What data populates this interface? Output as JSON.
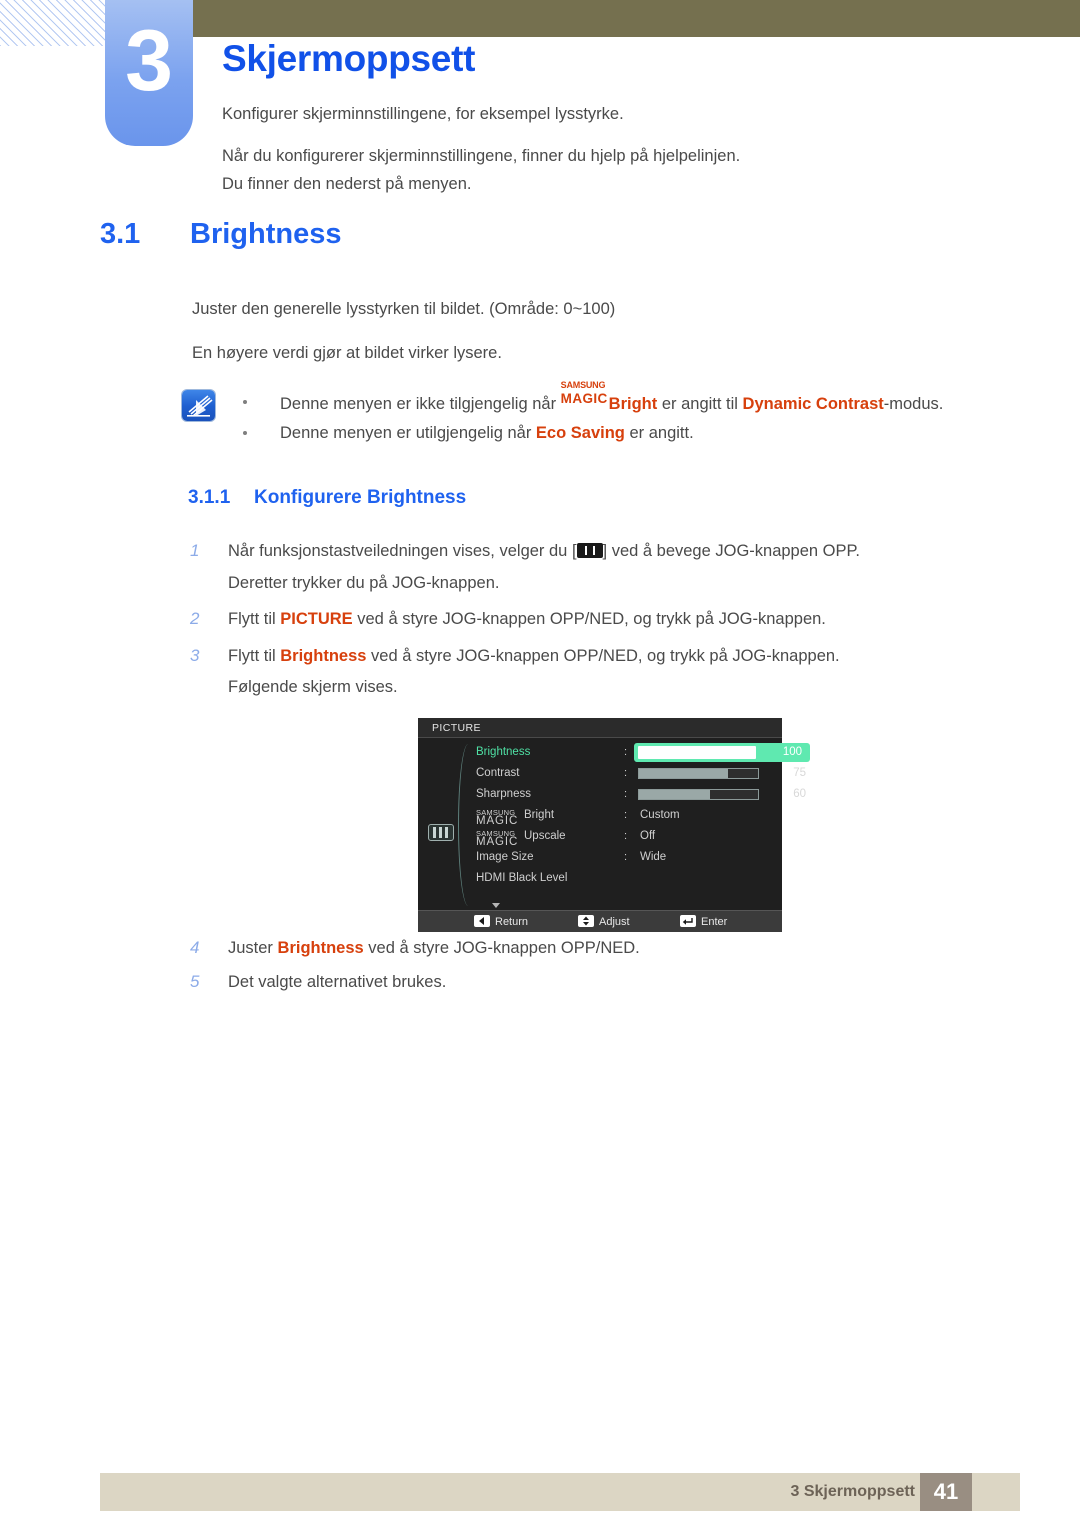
{
  "header": {
    "chapter_number": "3",
    "chapter_title": "Skjermoppsett",
    "intro_line_1": "Konfigurer skjerminnstillingene, for eksempel lysstyrke.",
    "intro_line_2": "Når du konfigurerer skjerminnstillingene, finner du hjelp på hjelpelinjen.",
    "intro_line_3": "Du finner den nederst på menyen."
  },
  "section": {
    "number": "3.1",
    "title": "Brightness",
    "para_1": "Juster den generelle lysstyrken til bildet. (Område: 0~100)",
    "para_2": "En høyere verdi gjør at bildet virker lysere."
  },
  "note": {
    "item_1_pre": "Denne menyen er ikke tilgjengelig når ",
    "item_1_magic_top": "SAMSUNG",
    "item_1_magic_bottom": "MAGIC",
    "item_1_bright": "Bright",
    "item_1_mid": " er angitt til ",
    "item_1_dynamic": "Dynamic Contrast",
    "item_1_post": "-modus.",
    "item_2_pre": "Denne menyen er utilgjengelig når ",
    "item_2_eco": "Eco Saving",
    "item_2_post": " er angitt."
  },
  "subsection": {
    "number": "3.1.1",
    "title": "Konfigurere Brightness"
  },
  "steps": {
    "s1_num": "1",
    "s1_pre": "Når funksjonstastveiledningen vises, velger du [",
    "s1_post": "] ved å bevege JOG-knappen OPP.",
    "s1_cont": "Deretter trykker du på JOG-knappen.",
    "s2_num": "2",
    "s2_pre": "Flytt til ",
    "s2_key": "PICTURE",
    "s2_post": " ved å styre JOG-knappen OPP/NED, og trykk på JOG-knappen.",
    "s3_num": "3",
    "s3_pre": "Flytt til ",
    "s3_key": "Brightness",
    "s3_post": " ved å styre JOG-knappen OPP/NED, og trykk på JOG-knappen.",
    "s3_cont": "Følgende skjerm vises.",
    "s4_num": "4",
    "s4_pre": "Juster ",
    "s4_key": "Brightness",
    "s4_post": " ved å styre JOG-knappen OPP/NED.",
    "s5_num": "5",
    "s5_text": "Det valgte alternativet brukes."
  },
  "osd": {
    "title": "PICTURE",
    "rows": [
      {
        "label": "Brightness",
        "colon": ":",
        "value": "100",
        "bar_percent": 100,
        "selected": true
      },
      {
        "label": "Contrast",
        "colon": ":",
        "value": "75",
        "bar_percent": 75,
        "selected": false
      },
      {
        "label": "Sharpness",
        "colon": ":",
        "value": "60",
        "bar_percent": 60,
        "selected": false
      }
    ],
    "magic_bright": {
      "top": "SAMSUNG",
      "bottom": "MAGIC",
      "rest": "Bright",
      "colon": ":",
      "value": "Custom"
    },
    "magic_upscale": {
      "top": "SAMSUNG",
      "bottom": "MAGIC",
      "rest": "Upscale",
      "colon": ":",
      "value": "Off"
    },
    "image_size": {
      "label": "Image Size",
      "colon": ":",
      "value": "Wide"
    },
    "hdmi_black_level": {
      "label": "HDMI Black Level"
    },
    "footer": {
      "return": "Return",
      "adjust": "Adjust",
      "enter": "Enter"
    }
  },
  "footer": {
    "text": "3 Skjermoppsett",
    "page": "41"
  },
  "colors": {
    "heading_blue": "#1f62ef",
    "chapter_blue": "#1151e8",
    "accent_orange": "#d7400d",
    "olive": "#75704f",
    "footer_bar": "#dcd6c4",
    "footer_page": "#998e82",
    "osd_green": "#5fe9b0"
  }
}
